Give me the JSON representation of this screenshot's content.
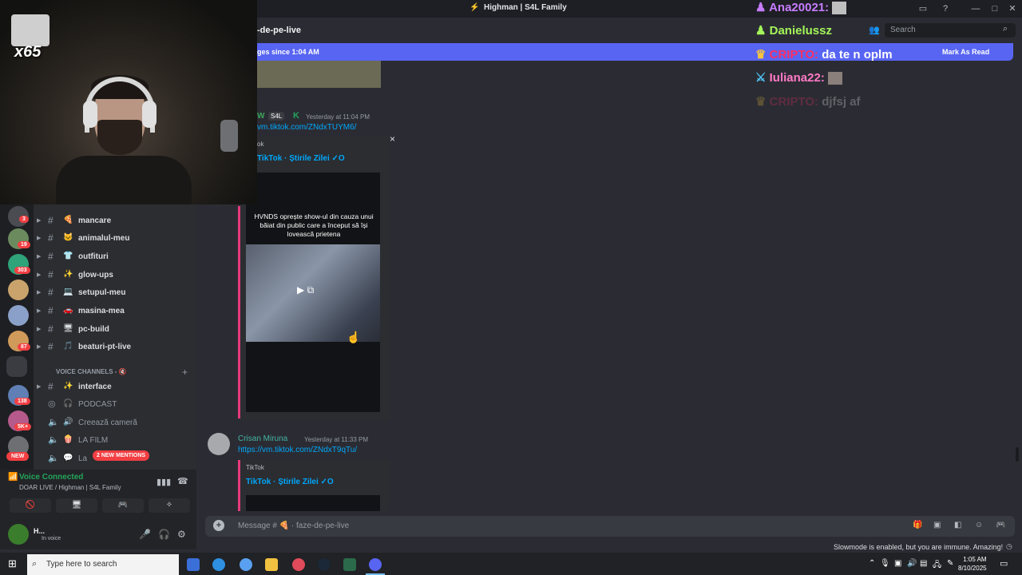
{
  "window": {
    "title": "Highman | S4L Family"
  },
  "header": {
    "channel": "-de-pe-live",
    "search_placeholder": "Search"
  },
  "banner": {
    "text": "ges since 1:04 AM",
    "mark_read": "Mark As Read"
  },
  "overlay_chat": [
    {
      "user": "Ana20021:",
      "text": "",
      "color": "#c77dff"
    },
    {
      "user": "Danielussz",
      "text": "",
      "color": "#a4f55a"
    },
    {
      "user": "CRIPTO:",
      "text": "da te n oplm",
      "color": "#ff2e63"
    },
    {
      "user": "Iuliana22:",
      "text": "",
      "color": "#ff7ac6"
    },
    {
      "user": "CRIPTO:",
      "text": "djfsj af",
      "color": "#ff2e63"
    }
  ],
  "webcam": {
    "multiplier": "x65"
  },
  "message1": {
    "author": "W",
    "tag": "S4L",
    "timestamp": "Yesterday at 11:04 PM",
    "link": "vm.tiktok.com/ZNdxTUYM6/",
    "provider": "ok",
    "embed_title": "TikTok · Știrile Zilei ✓O",
    "video_caption": "HVNDS oprește show-ul din cauza unui băiat din public care a început să își lovească prietena",
    "close": "×"
  },
  "message2": {
    "author": "Crisan Miruna",
    "timestamp": "Yesterday at 11:33 PM",
    "link": "https://vm.tiktok.com/ZNdxT9qTu/",
    "provider": "TikTok",
    "embed_title": "TikTok · Știrile Zilei ✓O"
  },
  "composer": {
    "placeholder": "Message # 🍕 · faze-de-pe-live"
  },
  "slowmode": "Slowmode is enabled, but you are immune. Amazing!",
  "guild_badges": [
    "3",
    "19",
    "303",
    "87",
    "138",
    "5K+"
  ],
  "new_badge": "NEW",
  "channels": [
    {
      "name": "mancare",
      "emoji": "🍕"
    },
    {
      "name": "animalul-meu",
      "emoji": "🐱"
    },
    {
      "name": "outfituri",
      "emoji": "👕"
    },
    {
      "name": "glow-ups",
      "emoji": "✨"
    },
    {
      "name": "setupul-meu",
      "emoji": "💻"
    },
    {
      "name": "masina-mea",
      "emoji": "🚗"
    },
    {
      "name": "pc-build",
      "emoji": "🖥"
    },
    {
      "name": "beaturi-pt-live",
      "emoji": "🎵"
    }
  ],
  "voice_header": "VOICE CHANNELS - 🔇",
  "voice_channels": [
    {
      "name": "interface",
      "emoji": "✨"
    },
    {
      "name": "PODCAST",
      "emoji": "🎧"
    },
    {
      "name": "Creează cameră",
      "emoji": "🔊"
    },
    {
      "name": "LA FILM",
      "emoji": "🍿"
    },
    {
      "name": "La",
      "emoji": "💬"
    }
  ],
  "mentions": "2 NEW MENTIONS",
  "voice_panel": {
    "title": "Voice Connected",
    "sub": "DOAR LIVE / Highman | S4L Family"
  },
  "user": {
    "name": "H...",
    "status": "In voice"
  },
  "taskbar": {
    "search_placeholder": "Type here to search",
    "time": "1:05 AM",
    "date": "8/10/2025"
  }
}
